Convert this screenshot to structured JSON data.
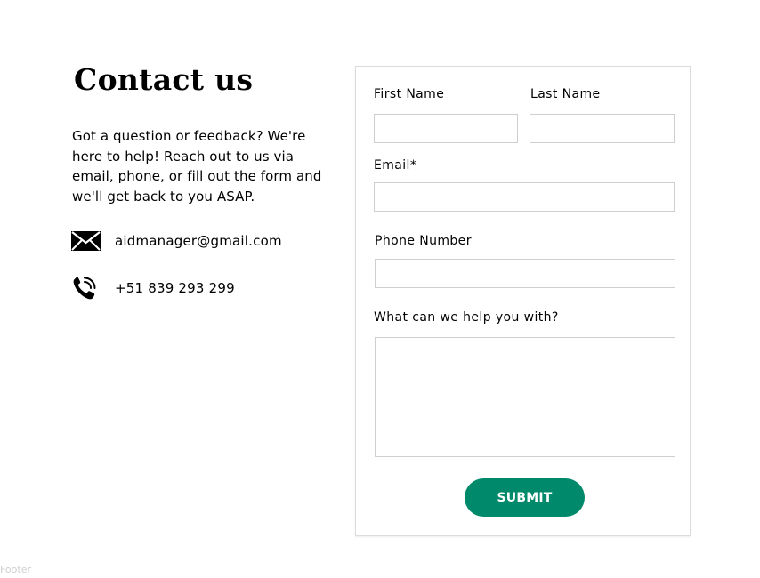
{
  "contact": {
    "title": "Contact us",
    "intro": "Got a question or feedback? We're here to help! Reach out to us via email, phone, or fill out the form and we'll get back to you ASAP.",
    "email": {
      "icon": "envelope-icon",
      "text": "aidmanager@gmail.com"
    },
    "phone": {
      "icon": "phone-icon",
      "text": "+51 839 293 299"
    }
  },
  "form": {
    "first_name": {
      "label": "First Name",
      "value": "",
      "placeholder": ""
    },
    "last_name": {
      "label": "Last Name",
      "value": "",
      "placeholder": ""
    },
    "email": {
      "label": "Email*",
      "value": "",
      "placeholder": ""
    },
    "phone": {
      "label": "Phone Number",
      "value": "",
      "placeholder": ""
    },
    "message": {
      "label": "What can we help you with?",
      "value": "",
      "placeholder": ""
    },
    "submit_label": "SUBMIT"
  },
  "footer": {
    "label": "Footer"
  },
  "colors": {
    "accent": "#00896a",
    "text": "#000000",
    "input_border": "#cfcfcf",
    "footer_text": "#cfcfcf"
  }
}
